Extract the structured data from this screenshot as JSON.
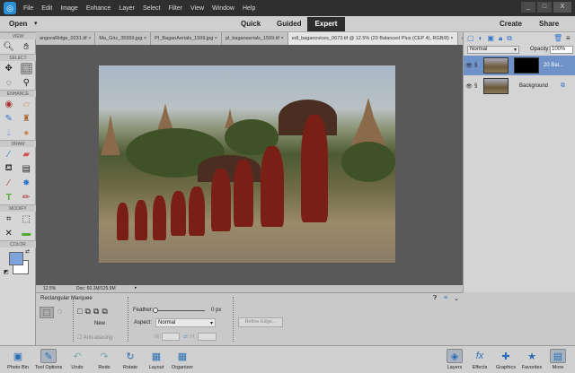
{
  "menubar": {
    "items": [
      "File",
      "Edit",
      "Image",
      "Enhance",
      "Layer",
      "Select",
      "Filter",
      "View",
      "Window",
      "Help"
    ],
    "controls": [
      "_",
      "□",
      "X"
    ]
  },
  "modebar": {
    "open": "Open",
    "modes": [
      "Quick",
      "Guided",
      "Expert"
    ],
    "create": "Create",
    "share": "Share"
  },
  "tabs": [
    "angoraRidge_0231.tif",
    "Ma_Griz_35559.jpg",
    "PI_BaganAerials_1599.jpg",
    "pl_baganaerials_1599.tif",
    "edl_baganovices_0673.tif @ 12.5% (20 Balanced Plus (CEP 4), RGB/8)"
  ],
  "toolbar": {
    "sections": [
      "VIEW",
      "SELECT",
      "ENHANCE",
      "DRAW",
      "MODIFY",
      "COLOR"
    ],
    "colors": {
      "foreground": "#7fa3dc",
      "background": "#ffffff"
    }
  },
  "layers": {
    "blend_mode": "Normal",
    "opacity_label": "Opacity:",
    "opacity": "100%",
    "items": [
      {
        "name": "20 Bal...",
        "selected": true
      },
      {
        "name": "Background",
        "selected": false
      }
    ]
  },
  "status": {
    "zoom": "12.5%",
    "doc": "Doc: 60.1M/125.9M"
  },
  "tool_options": {
    "title": "Rectangular Marquee",
    "mode_label": "New",
    "anti_alias": "Anti-aliasing",
    "feather_label": "Feather:",
    "feather_value": "0 px",
    "aspect_label": "Aspect:",
    "aspect_value": "Normal",
    "w_label": "W:",
    "h_label": "H:",
    "refine": "Refine Edge..."
  },
  "taskbar": {
    "left": [
      "Photo Bin",
      "Tool Options",
      "Undo",
      "Redo",
      "Rotate",
      "Layout",
      "Organizer"
    ],
    "right": [
      "Layers",
      "Effects",
      "Graphics",
      "Favorites",
      "More"
    ]
  }
}
